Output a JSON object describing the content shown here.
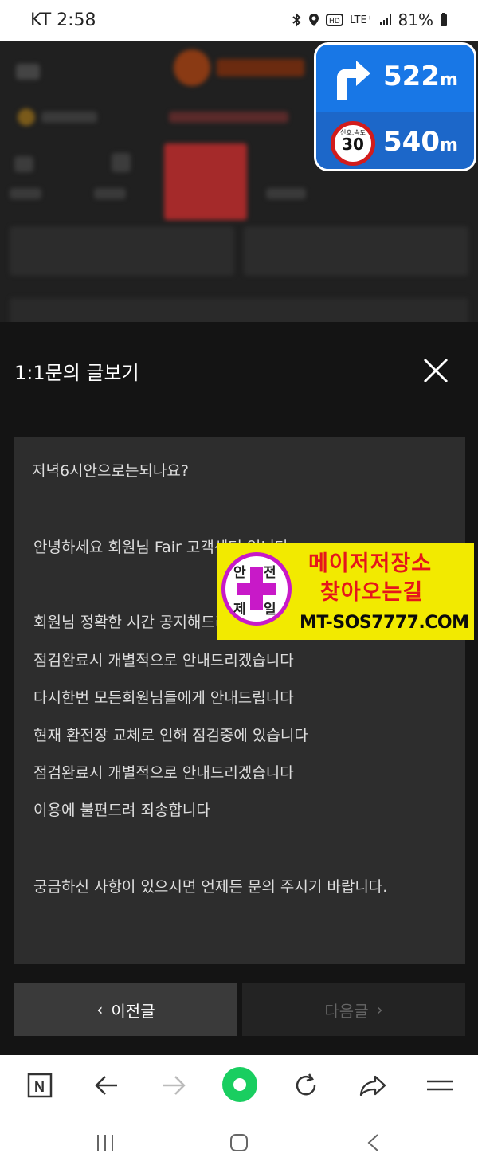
{
  "status_bar": {
    "carrier_time": "KT 2:58",
    "icons": [
      "bluetooth-icon",
      "location-icon",
      "hd-icon",
      "lte-icon",
      "signal-icon",
      "battery-icon"
    ],
    "lte": "LTE⁺",
    "battery": "81%"
  },
  "nav_overlay": {
    "turn_distance": "522",
    "speed_limit_label": "신호,속도",
    "speed_limit": "30",
    "camera_distance": "540",
    "unit": "m"
  },
  "modal": {
    "title": "1:1문의 글보기",
    "subject": "저녁6시안으로는되나요?",
    "body_lines": [
      "안녕하세요 회원님 Fair 고객센터 입니다.",
      "",
      "회원님 정확한 시간 공지해드리기 어렵습니다",
      "점검완료시 개별적으로 안내드리겠습니다",
      "다시한번 모든회원님들에게 안내드립니다",
      "현재 환전장 교체로 인해 점검중에 있습니다",
      "점검완료시  개별적으로 안내드리겠습니다",
      "이용에 불편드려 죄송합니다",
      "",
      "궁금하신 사항이 있으시면 언제든 문의 주시기 바랍니다."
    ],
    "prev_label": "이전글",
    "next_label": "다음글"
  },
  "ad_banner": {
    "logo_chars": [
      "안",
      "전",
      "제",
      "일"
    ],
    "line1": "메이저저장소",
    "line2": "찾아오는길",
    "url": "MT-SOS7777.COM"
  },
  "browser_toolbar": {
    "items": [
      "naver-n-icon",
      "back-icon",
      "forward-icon",
      "green-dot-icon",
      "reload-icon",
      "share-icon",
      "menu-icon"
    ],
    "naver_letter": "N"
  },
  "colors": {
    "ad_bg": "#f2ea00",
    "ad_red": "#e5161b",
    "logo_magenta": "#c819c8",
    "nav_blue": "#1877e6",
    "green": "#19ce60"
  }
}
